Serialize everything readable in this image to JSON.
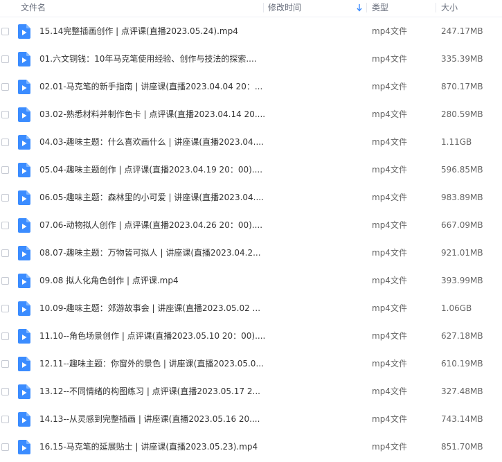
{
  "header": {
    "col_name": "文件名",
    "col_modified": "修改时间",
    "col_type": "类型",
    "col_size": "大小"
  },
  "colors": {
    "icon_blue": "#3b8cff",
    "icon_blue_light": "#7fb6ff",
    "sort_arrow": "#3b8cff"
  },
  "icons": {
    "file": "video-file-icon",
    "sort": "sort-down-arrow-icon"
  },
  "files": [
    {
      "name": "15.14完整插画创作 | 点评课(直播2023.05.24).mp4",
      "type": "mp4文件",
      "size": "247.17MB"
    },
    {
      "name": "01.六文铜钱：10年马克笔使用经验、创作与技法的探索....",
      "type": "mp4文件",
      "size": "335.39MB"
    },
    {
      "name": "02.01-马克笔的新手指南 | 讲座课(直播2023.04.04 20：...",
      "type": "mp4文件",
      "size": "870.17MB"
    },
    {
      "name": "03.02-熟悉材料并制作色卡 | 点评课(直播2023.04.14 20....",
      "type": "mp4文件",
      "size": "280.59MB"
    },
    {
      "name": "04.03-趣味主题：什么喜欢画什么 | 讲座课(直播2023.04....",
      "type": "mp4文件",
      "size": "1.11GB"
    },
    {
      "name": "05.04-趣味主题创作 | 点评课(直播2023.04.19 20：00)....",
      "type": "mp4文件",
      "size": "596.85MB"
    },
    {
      "name": "06.05-趣味主题：森林里的小可爱 | 讲座课(直播2023.04....",
      "type": "mp4文件",
      "size": "983.89MB"
    },
    {
      "name": "07.06-动物拟人创作 | 点评课(直播2023.04.26 20：00)....",
      "type": "mp4文件",
      "size": "667.09MB"
    },
    {
      "name": "08.07-趣味主题：万物皆可拟人 | 讲座课(直播2023.04.2...",
      "type": "mp4文件",
      "size": "921.01MB"
    },
    {
      "name": "09.08 拟人化角色创作 | 点评课.mp4",
      "type": "mp4文件",
      "size": "393.99MB"
    },
    {
      "name": "10.09-趣味主题：郊游故事会 | 讲座课(直播2023.05.02 ...",
      "type": "mp4文件",
      "size": "1.06GB"
    },
    {
      "name": "11.10--角色场景创作 | 点评课(直播2023.05.10 20：00)....",
      "type": "mp4文件",
      "size": "627.18MB"
    },
    {
      "name": "12.11--趣味主题：你窗外的景色 | 讲座课(直播2023.05.0...",
      "type": "mp4文件",
      "size": "610.19MB"
    },
    {
      "name": "13.12--不同情绪的构图练习 | 点评课(直播2023.05.17 2...",
      "type": "mp4文件",
      "size": "327.48MB"
    },
    {
      "name": "14.13--从灵感到完整插画 | 讲座课(直播2023.05.16 20....",
      "type": "mp4文件",
      "size": "743.14MB"
    },
    {
      "name": "16.15-马克笔的延展贴士 | 讲座课(直播2023.05.23).mp4",
      "type": "mp4文件",
      "size": "851.70MB"
    }
  ]
}
